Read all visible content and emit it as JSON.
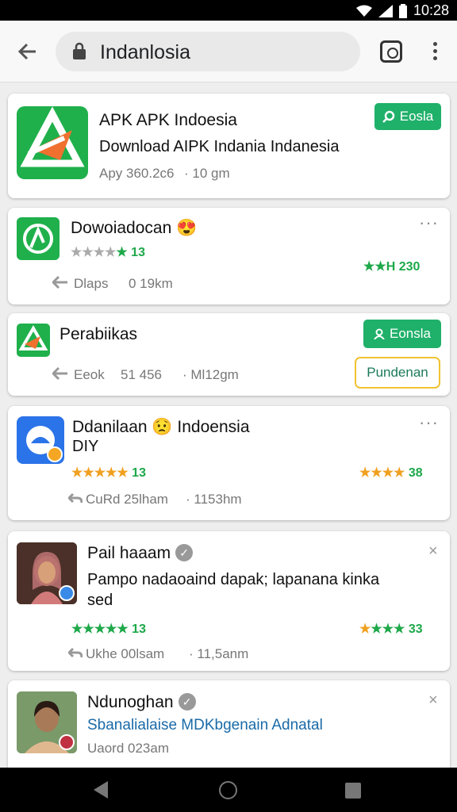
{
  "status_bar": {
    "time": "10:28"
  },
  "browser": {
    "url": "Indanlosia"
  },
  "cards": [
    {
      "title": "APK APK Indoesia",
      "subtitle": "Download AIPK Indania Indanesia",
      "meta_left": "Apy 360.2c6",
      "meta_right": "· 10 gm",
      "button": "Eosla"
    },
    {
      "title": "Dowoiadocan",
      "rating_left": "13",
      "rating_right": "230",
      "meta_left": "Dlaps",
      "meta_right": "0 19km"
    },
    {
      "title": "Perabiikas",
      "meta_left": "Eeok",
      "meta_mid": "51 456",
      "meta_right": "· Ml12gm",
      "button": "Eonsla",
      "button_outline": "Pundenan"
    },
    {
      "title": "Ddanilaan",
      "title_suffix": "Indoensia",
      "line2": "DIY",
      "rating_left": "13",
      "rating_right": "38",
      "meta_left": "CuRd 25lham",
      "meta_right": "· 1153hm"
    },
    {
      "title": "Pail haaam",
      "body": "Pampo nadaoaind dapak; lapanana kinka",
      "body2": "sed",
      "rating_left": "13",
      "rating_right": "33",
      "meta_left": "Ukhe 00lsam",
      "meta_right": "· 11,5anm"
    },
    {
      "title": "Ndunoghan",
      "body": "Sbanalialaise MDKbgenain Adnatal",
      "meta_left": "Uaord 023am"
    }
  ]
}
